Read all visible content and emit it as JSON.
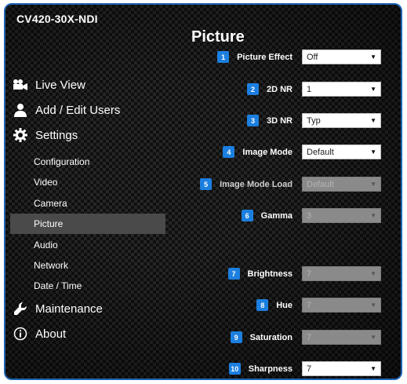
{
  "header": {
    "model": "CV420-30X-NDI"
  },
  "nav": {
    "live_view": "Live View",
    "add_edit_users": "Add / Edit Users",
    "settings": "Settings",
    "sub": [
      "Configuration",
      "Video",
      "Camera",
      "Picture",
      "Audio",
      "Network",
      "Date / Time"
    ],
    "maintenance": "Maintenance",
    "about": "About"
  },
  "page": {
    "title": "Picture"
  },
  "fields": [
    {
      "num": "1",
      "label": "Picture Effect",
      "value": "Off",
      "enabled": true
    },
    {
      "num": "2",
      "label": "2D NR",
      "value": "1",
      "enabled": true
    },
    {
      "num": "3",
      "label": "3D NR",
      "value": "Typ",
      "enabled": true
    },
    {
      "num": "4",
      "label": "Image Mode",
      "value": "Default",
      "enabled": true
    },
    {
      "num": "5",
      "label": "Image Mode Load",
      "value": "Default",
      "enabled": false
    },
    {
      "num": "6",
      "label": "Gamma",
      "value": "3",
      "enabled": false
    },
    {
      "num": "7",
      "label": "Brightness",
      "value": "7",
      "enabled": false
    },
    {
      "num": "8",
      "label": "Hue",
      "value": "7",
      "enabled": false
    },
    {
      "num": "9",
      "label": "Saturation",
      "value": "7",
      "enabled": false
    },
    {
      "num": "10",
      "label": "Sharpness",
      "value": "7",
      "enabled": true
    }
  ],
  "colors": {
    "accent": "#1c7fe0",
    "border": "#1e64b4",
    "active_nav": "#4a4a4a"
  }
}
